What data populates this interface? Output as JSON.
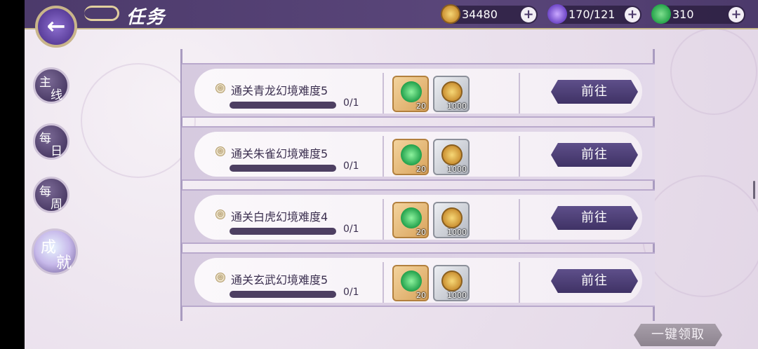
{
  "header": {
    "title": "任务",
    "back_label": "←"
  },
  "resources": [
    {
      "name": "coin",
      "value": "34480",
      "plus": "+"
    },
    {
      "name": "spirit",
      "value": "170/121",
      "plus": "+"
    },
    {
      "name": "jade",
      "value": "310",
      "plus": "+"
    }
  ],
  "sidebar": {
    "tabs": [
      {
        "c1": "主",
        "c2": "线",
        "active": false
      },
      {
        "c1": "每",
        "c2": "日",
        "active": false
      },
      {
        "c1": "每",
        "c2": "周",
        "active": false
      },
      {
        "c1": "成",
        "c2": "就",
        "active": true
      }
    ]
  },
  "tasks": [
    {
      "name": "通关青龙幻境难度5",
      "progress": "0/1",
      "progress_fraction": 0,
      "rewards": [
        {
          "type": "jade",
          "qty": "20"
        },
        {
          "type": "coin",
          "qty": "1000"
        }
      ],
      "action": "前往"
    },
    {
      "name": "通关朱雀幻境难度5",
      "progress": "0/1",
      "progress_fraction": 0,
      "rewards": [
        {
          "type": "jade",
          "qty": "20"
        },
        {
          "type": "coin",
          "qty": "1000"
        }
      ],
      "action": "前往"
    },
    {
      "name": "通关白虎幻境难度4",
      "progress": "0/1",
      "progress_fraction": 0,
      "rewards": [
        {
          "type": "jade",
          "qty": "20"
        },
        {
          "type": "coin",
          "qty": "1000"
        }
      ],
      "action": "前往"
    },
    {
      "name": "通关玄武幻境难度5",
      "progress": "0/1",
      "progress_fraction": 0,
      "rewards": [
        {
          "type": "jade",
          "qty": "20"
        },
        {
          "type": "coin",
          "qty": "1000"
        }
      ],
      "action": "前往"
    }
  ],
  "footer": {
    "claim_all": "一键领取"
  },
  "colors": {
    "topbar": "#4c3a6b",
    "button": "#4f4177",
    "accent_gold": "#c9b58a"
  }
}
